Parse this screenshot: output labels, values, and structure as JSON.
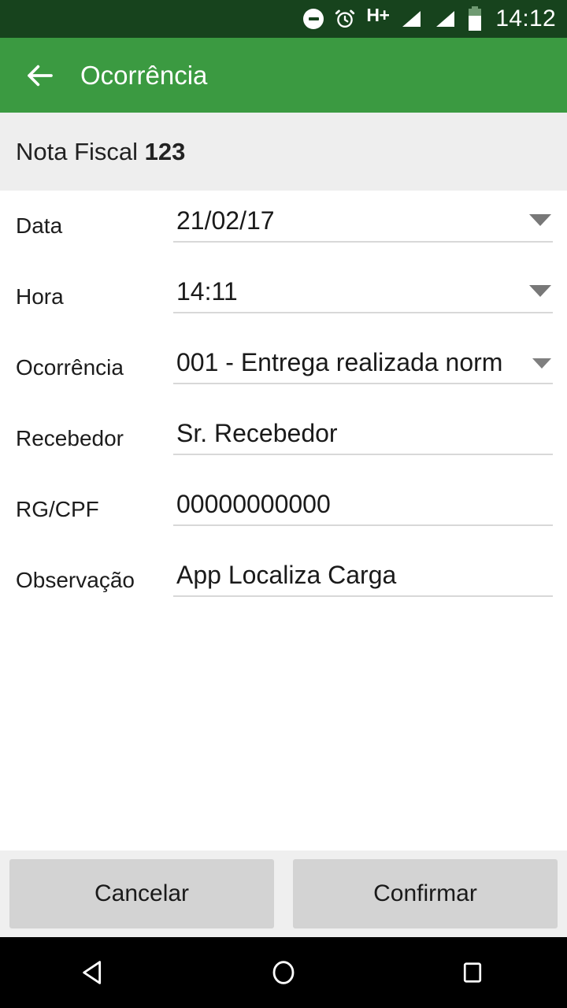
{
  "status_bar": {
    "icons": [
      "do-not-disturb-icon",
      "alarm-clock-icon",
      "signal-bar-icon",
      "signal-bar-icon",
      "battery-icon"
    ],
    "network_label": "H+",
    "time": "14:12",
    "background_color": "#17431d"
  },
  "app_bar": {
    "back_icon": "arrow-left-icon",
    "title": "Ocorrência",
    "background_color": "#3b9a41"
  },
  "subtitle": {
    "label": "Nota Fiscal",
    "value": "123",
    "background_color": "#eeeeee"
  },
  "form": {
    "fields": [
      {
        "label": "Data",
        "value": "21/02/17",
        "has_dropdown": true,
        "name": "data"
      },
      {
        "label": "Hora",
        "value": "14:11",
        "has_dropdown": true,
        "name": "hora"
      },
      {
        "label": "Ocorrência",
        "value": "001 - Entrega realizada norm",
        "has_dropdown": true,
        "name": "ocorrencia"
      },
      {
        "label": "Recebedor",
        "value": "Sr. Recebedor",
        "has_dropdown": false,
        "name": "recebedor"
      },
      {
        "label": "RG/CPF",
        "value": "00000000000",
        "has_dropdown": false,
        "name": "rg-cpf"
      },
      {
        "label": "Observação",
        "value": "App Localiza Carga",
        "has_dropdown": false,
        "name": "observacao"
      }
    ]
  },
  "footer": {
    "cancel_label": "Cancelar",
    "confirm_label": "Confirmar",
    "background_color": "#efefef",
    "button_color": "#d3d3d3"
  },
  "nav_bar": {
    "back_icon": "triangle-back-icon",
    "home_icon": "circle-home-icon",
    "recents_icon": "square-recents-icon",
    "background_color": "#000000"
  }
}
